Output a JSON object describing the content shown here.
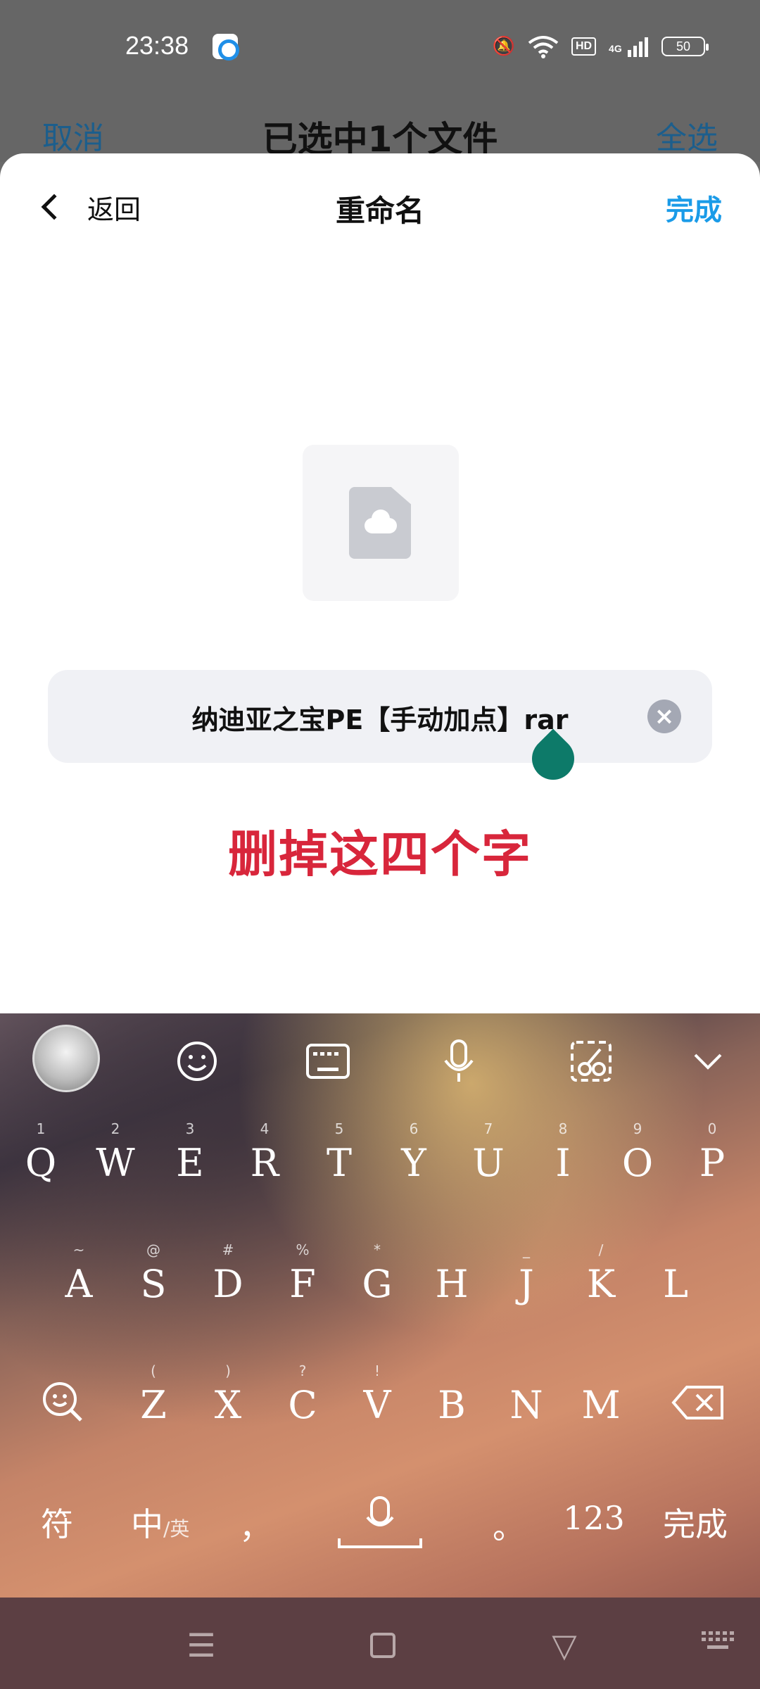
{
  "status_bar": {
    "time": "23:38",
    "battery": "50",
    "network": "4G",
    "hd": "HD"
  },
  "background_bar": {
    "cancel": "取消",
    "title": "已选中1个文件",
    "select_all": "全选"
  },
  "sheet": {
    "back_label": "返回",
    "title": "重命名",
    "done": "完成",
    "file_name": "纳迪亚之宝PE【手动加点】rar",
    "annotation": "删掉这四个字"
  },
  "keyboard": {
    "row1": [
      {
        "hint": "1",
        "key": "Q"
      },
      {
        "hint": "2",
        "key": "W"
      },
      {
        "hint": "3",
        "key": "E"
      },
      {
        "hint": "4",
        "key": "R"
      },
      {
        "hint": "5",
        "key": "T"
      },
      {
        "hint": "6",
        "key": "Y"
      },
      {
        "hint": "7",
        "key": "U"
      },
      {
        "hint": "8",
        "key": "I"
      },
      {
        "hint": "9",
        "key": "O"
      },
      {
        "hint": "0",
        "key": "P"
      }
    ],
    "row2": [
      {
        "hint": "~",
        "key": "A"
      },
      {
        "hint": "@",
        "key": "S"
      },
      {
        "hint": "#",
        "key": "D"
      },
      {
        "hint": "%",
        "key": "F"
      },
      {
        "hint": "*",
        "key": "G"
      },
      {
        "hint": "",
        "key": "H"
      },
      {
        "hint": "_",
        "key": "J"
      },
      {
        "hint": "/",
        "key": "K"
      },
      {
        "hint": "",
        "key": "L"
      }
    ],
    "row3": [
      {
        "hint": "(",
        "key": "Z"
      },
      {
        "hint": ")",
        "key": "X"
      },
      {
        "hint": "?",
        "key": "C"
      },
      {
        "hint": "!",
        "key": "V"
      },
      {
        "hint": "",
        "key": "B"
      },
      {
        "hint": "",
        "key": "N"
      },
      {
        "hint": "",
        "key": "M"
      }
    ],
    "bottom": {
      "symbols": "符",
      "lang_main": "中",
      "lang_alt": "/英",
      "comma": "，",
      "period": "。",
      "numbers": "123",
      "done": "完成"
    }
  },
  "colors": {
    "accent": "#1a9be8",
    "annotation": "#d8263b",
    "cursor": "#0d7a69"
  }
}
